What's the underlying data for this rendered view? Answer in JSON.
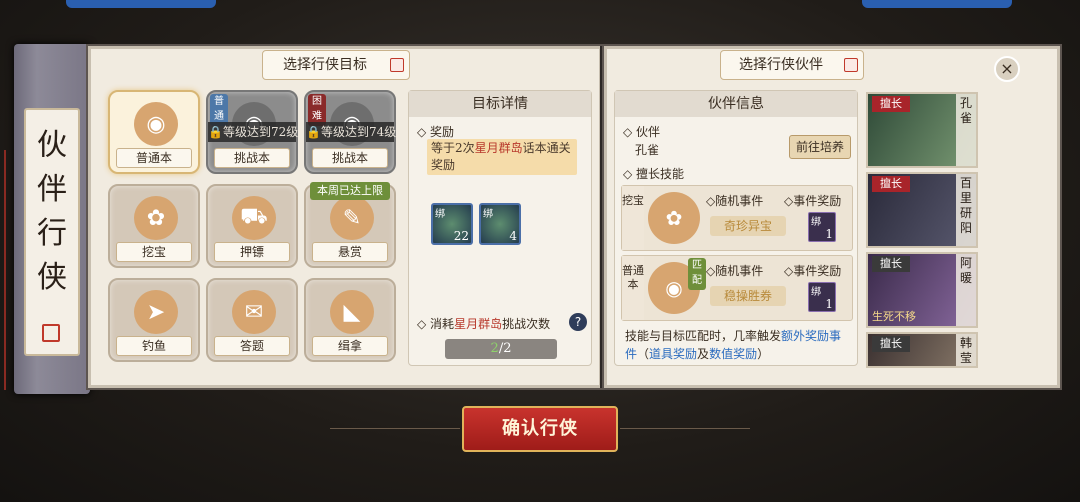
{
  "scroll_title": "伙伴行侠",
  "left_panel": {
    "banner": "选择行侠目标",
    "tiles": [
      {
        "label": "普通本",
        "selected": true,
        "icon": "mask-icon"
      },
      {
        "label": "挑战本",
        "tag": "普通",
        "lock": "等级达到72级",
        "icon": "mask-icon"
      },
      {
        "label": "挑战本",
        "tag": "困难",
        "lock": "等级达到74级",
        "icon": "mask-icon"
      },
      {
        "label": "挖宝",
        "icon": "shovel-icon"
      },
      {
        "label": "押镖",
        "icon": "cart-icon"
      },
      {
        "label": "悬赏",
        "tag": "本周已达上限",
        "icon": "knife-icon"
      },
      {
        "label": "钓鱼",
        "icon": "fish-icon"
      },
      {
        "label": "答题",
        "icon": "scroll-icon"
      },
      {
        "label": "缉拿",
        "icon": "cloth-icon"
      }
    ]
  },
  "detail": {
    "header": "目标详情",
    "reward_label": "奖励",
    "reward_text_pre": "等于2次",
    "reward_text_hl": "星月群岛",
    "reward_text_post": "话本通关奖励",
    "items": [
      {
        "bind": "绑",
        "count": "22"
      },
      {
        "bind": "绑",
        "count": "4"
      }
    ],
    "consume_pre": "消耗",
    "consume_hl": "星月群岛",
    "consume_post": "挑战次数",
    "count_used": "2",
    "count_total": "/2"
  },
  "right_panel": {
    "banner": "选择行侠伙伴",
    "header": "伙伴信息",
    "partner_label": "伙伴",
    "partner_name": "孔雀",
    "go_train": "前往培养",
    "skill_label": "擅长技能",
    "skills": [
      {
        "side": "挖宝",
        "event_label": "随机事件",
        "reward_label": "事件奖励",
        "event": "奇珍异宝",
        "chest_bind": "绑",
        "chest_count": "1"
      },
      {
        "side": "普通本",
        "match": "匹配",
        "event_label": "随机事件",
        "reward_label": "事件奖励",
        "event": "稳操胜券",
        "chest_bind": "绑",
        "chest_count": "1"
      }
    ],
    "footer_pre": "技能与目标匹配时，几率触发",
    "footer_hl": "额外奖励事件",
    "footer_paren_open": "（",
    "footer_blue1": "道具奖励",
    "footer_and": "及",
    "footer_blue2": "数值奖励",
    "footer_paren_close": "）"
  },
  "portraits": [
    {
      "tag": "擅长",
      "name": "孔雀"
    },
    {
      "tag": "擅长",
      "name": "百里研阳"
    },
    {
      "tag": "擅长",
      "name": "阿暖",
      "sub": "生死不移"
    },
    {
      "tag": "擅长",
      "name": "韩莹"
    }
  ],
  "confirm_button": "确认行侠",
  "close_icon": "×",
  "colors": {
    "accent_red": "#b8392c",
    "confirm": "#b52a25",
    "match_green": "#6e8f3a",
    "link_blue": "#2a6bbf"
  }
}
